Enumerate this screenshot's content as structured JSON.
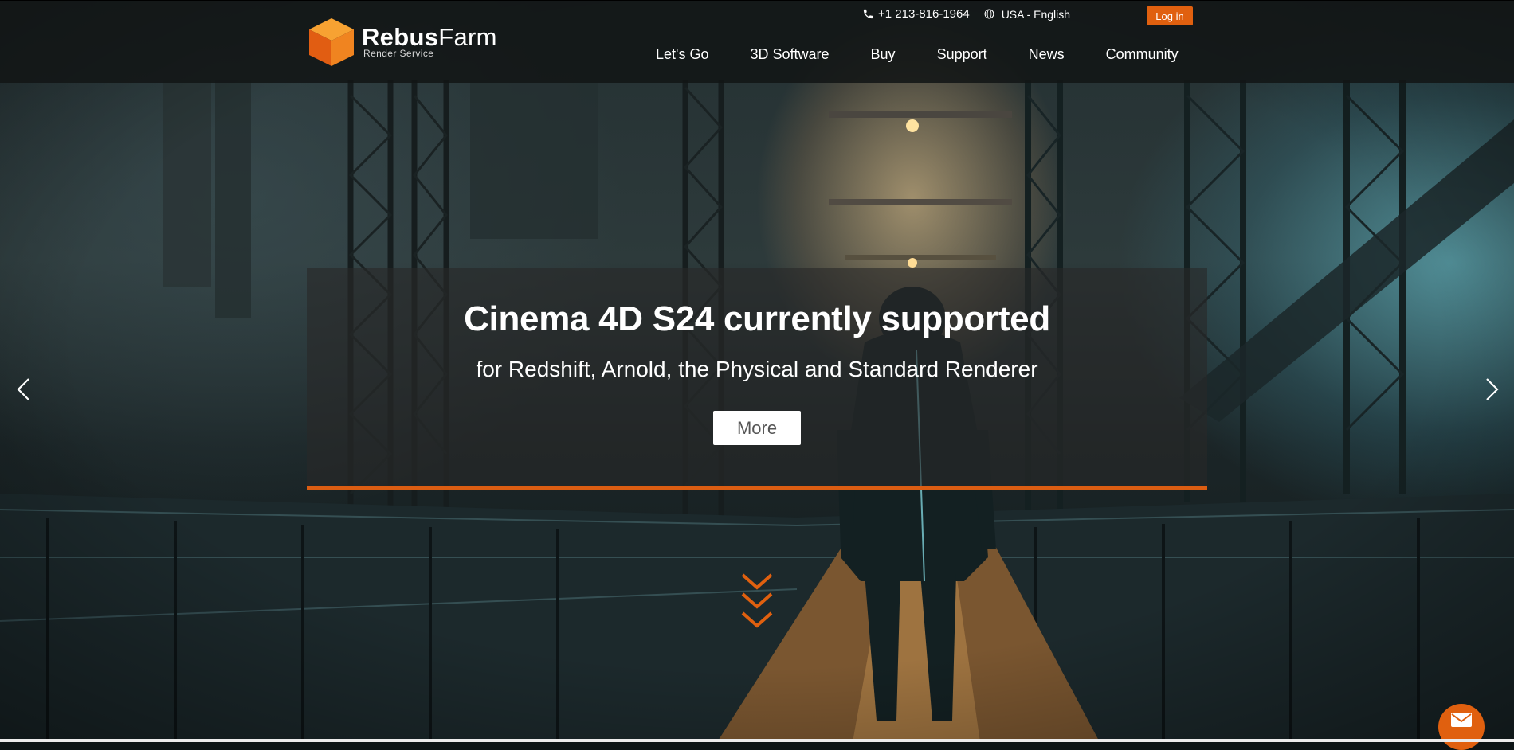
{
  "brand": {
    "name_bold": "Rebus",
    "name_regular": "Farm",
    "tagline": "Render Service",
    "accent_color": "#e0600f"
  },
  "topbar": {
    "phone": "+1 213-816-1964",
    "phone_icon": "phone-icon",
    "language": "USA - English",
    "language_icon": "globe-icon",
    "login_label": "Log in"
  },
  "nav": {
    "items": [
      {
        "label": "Let's Go"
      },
      {
        "label": "3D Software"
      },
      {
        "label": "Buy"
      },
      {
        "label": "Support"
      },
      {
        "label": "News"
      },
      {
        "label": "Community"
      }
    ]
  },
  "slide": {
    "title": "Cinema 4D S24 currently supported",
    "subtitle": "for Redshift, Arnold, the Physical and Standard Renderer",
    "button_label": "More"
  },
  "controls": {
    "prev_icon": "chevron-left-icon",
    "next_icon": "chevron-right-icon",
    "scroll_icon": "triple-chevron-down-icon",
    "contact_icon": "envelope-icon"
  }
}
